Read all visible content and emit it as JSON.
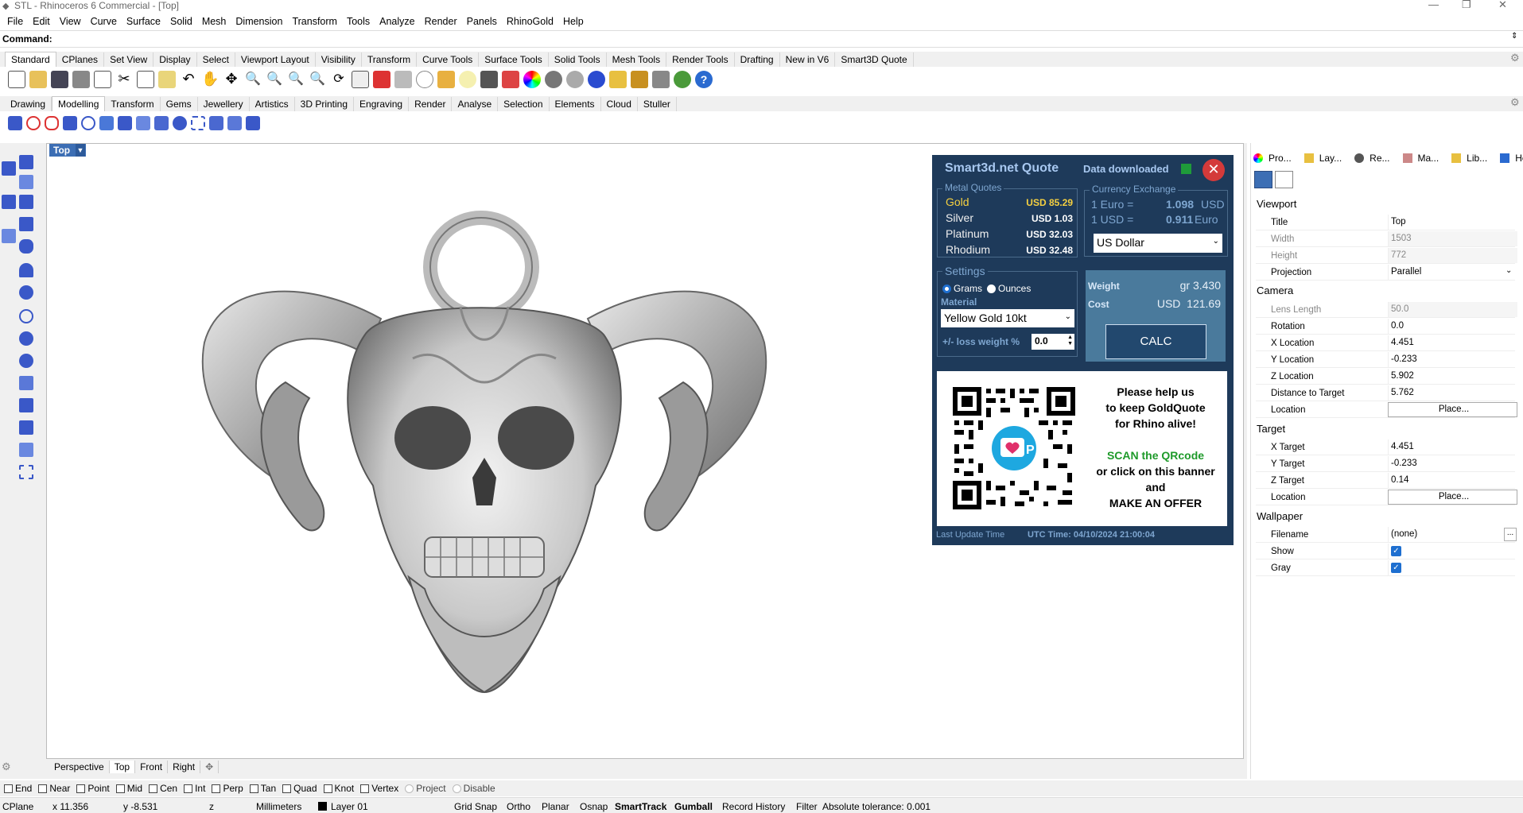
{
  "window": {
    "title": "STL - Rhinoceros 6 Commercial - [Top]"
  },
  "menu": [
    "File",
    "Edit",
    "View",
    "Curve",
    "Surface",
    "Solid",
    "Mesh",
    "Dimension",
    "Transform",
    "Tools",
    "Analyze",
    "Render",
    "Panels",
    "RhinoGold",
    "Help"
  ],
  "command": {
    "label": "Command:",
    "value": ""
  },
  "toolbar_tabs": [
    "Standard",
    "CPlanes",
    "Set View",
    "Display",
    "Select",
    "Viewport Layout",
    "Visibility",
    "Transform",
    "Curve Tools",
    "Surface Tools",
    "Solid Tools",
    "Mesh Tools",
    "Render Tools",
    "Drafting",
    "New in V6",
    "Smart3D Quote"
  ],
  "toolbar_tabs2": [
    "Drawing",
    "Modelling",
    "Transform",
    "Gems",
    "Jewellery",
    "Artistics",
    "3D Printing",
    "Engraving",
    "Render",
    "Analyse",
    "Selection",
    "Elements",
    "Cloud",
    "Stuller"
  ],
  "viewport": {
    "name": "Top",
    "tabs": [
      "Perspective",
      "Top",
      "Front",
      "Right"
    ]
  },
  "quote": {
    "title": "Smart3d.net Quote",
    "status": "Data downloaded",
    "metal_quotes_label": "Metal Quotes",
    "metals": [
      {
        "name": "Gold",
        "price": "USD 85.29"
      },
      {
        "name": "Silver",
        "price": "USD 1.03"
      },
      {
        "name": "Platinum",
        "price": "USD 32.03"
      },
      {
        "name": "Rhodium",
        "price": "USD 32.48"
      }
    ],
    "currency_label": "Currency Exchange",
    "rate1_label": "1 Euro =",
    "rate1_value": "1.098",
    "rate1_unit": "USD",
    "rate2_label": "1 USD =",
    "rate2_value": "0.911",
    "rate2_unit": "Euro",
    "currency_selected": "US Dollar",
    "settings_label": "Settings",
    "unit_grams": "Grams",
    "unit_ounces": "Ounces",
    "material_label": "Material",
    "material_selected": "Yellow Gold 10kt",
    "loss_label": "+/- loss weight %",
    "loss_value": "0.0",
    "weight_label": "Weight",
    "weight_value": "gr 3.430",
    "cost_label": "Cost",
    "cost_value": "USD  121.69",
    "calc_label": "CALC",
    "banner_l1": "Please help us",
    "banner_l2": "to keep GoldQuote",
    "banner_l3": "for Rhino alive!",
    "banner_l4": "SCAN the QRcode",
    "banner_l5": "or click on this banner",
    "banner_l6": "and",
    "banner_l7": "MAKE AN OFFER",
    "last_update_label": "Last Update Time",
    "utc_time": "UTC Time: 04/10/2024 21:00:04"
  },
  "panel_tabs": [
    "Pro...",
    "Lay...",
    "Re...",
    "Ma...",
    "Lib...",
    "Help"
  ],
  "properties": {
    "viewport_section": "Viewport",
    "viewport": [
      {
        "k": "Title",
        "v": "Top"
      },
      {
        "k": "Width",
        "v": "1503"
      },
      {
        "k": "Height",
        "v": "772"
      },
      {
        "k": "Projection",
        "v": "Parallel"
      }
    ],
    "camera_section": "Camera",
    "camera": [
      {
        "k": "Lens Length",
        "v": "50.0"
      },
      {
        "k": "Rotation",
        "v": "0.0"
      },
      {
        "k": "X Location",
        "v": "4.451"
      },
      {
        "k": "Y Location",
        "v": "-0.233"
      },
      {
        "k": "Z Location",
        "v": "5.902"
      },
      {
        "k": "Distance to Target",
        "v": "5.762"
      },
      {
        "k": "Location",
        "v": "Place..."
      }
    ],
    "target_section": "Target",
    "target": [
      {
        "k": "X Target",
        "v": "4.451"
      },
      {
        "k": "Y Target",
        "v": "-0.233"
      },
      {
        "k": "Z Target",
        "v": "0.14"
      },
      {
        "k": "Location",
        "v": "Place..."
      }
    ],
    "wallpaper_section": "Wallpaper",
    "wallpaper": [
      {
        "k": "Filename",
        "v": "(none)"
      },
      {
        "k": "Show",
        "v": ""
      },
      {
        "k": "Gray",
        "v": ""
      }
    ]
  },
  "osnaps": [
    "End",
    "Near",
    "Point",
    "Mid",
    "Cen",
    "Int",
    "Perp",
    "Tan",
    "Quad",
    "Knot",
    "Vertex",
    "Project",
    "Disable"
  ],
  "status": {
    "cplane": "CPlane",
    "x": "x 11.356",
    "y": "y -8.531",
    "z": "z",
    "units": "Millimeters",
    "layer": "Layer 01",
    "grid_snap": "Grid Snap",
    "ortho": "Ortho",
    "planar": "Planar",
    "osnap": "Osnap",
    "smarttrack": "SmartTrack",
    "gumball": "Gumball",
    "record_history": "Record History",
    "filter": "Filter",
    "tolerance": "Absolute tolerance: 0.001"
  }
}
